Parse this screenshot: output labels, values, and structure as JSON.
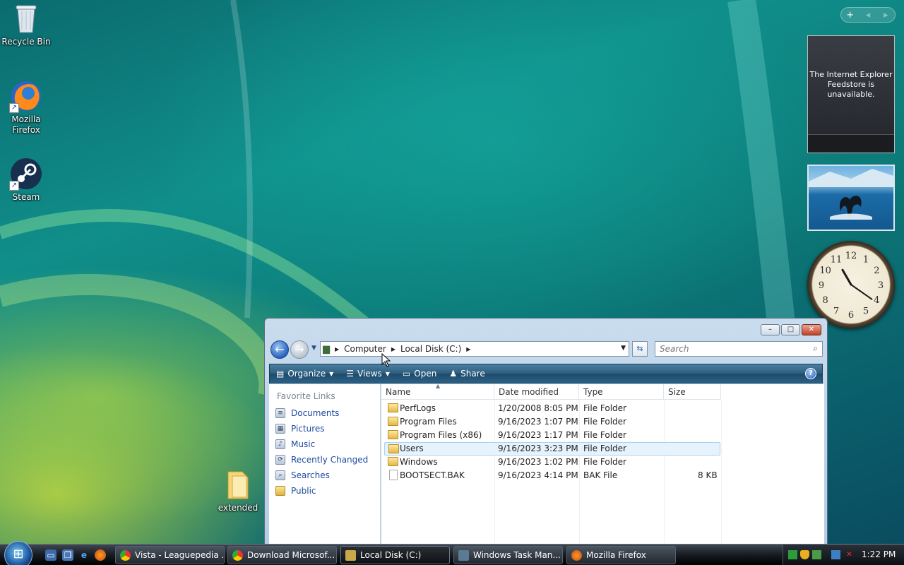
{
  "desktop": {
    "icons": [
      {
        "label": "Recycle Bin",
        "icon": "recycle-bin-icon"
      },
      {
        "label": "Mozilla\nFirefox",
        "line1": "Mozilla",
        "line2": "Firefox",
        "icon": "firefox-icon"
      },
      {
        "label": "Steam",
        "icon": "steam-icon"
      },
      {
        "label": "extended",
        "icon": "folder-icon"
      }
    ]
  },
  "sidebar": {
    "controls": {
      "add": "+",
      "prev": "◂",
      "next": "▸"
    },
    "feed_message_1": "The Internet Explorer",
    "feed_message_2": "Feedstore is",
    "feed_message_3": "unavailable.",
    "clock_numbers": [
      "12",
      "1",
      "2",
      "3",
      "4",
      "5",
      "6",
      "7",
      "8",
      "9",
      "10",
      "11"
    ]
  },
  "explorer": {
    "address": {
      "seg1": "Computer",
      "seg2": "Local Disk (C:)"
    },
    "search_placeholder": "Search",
    "toolbar": {
      "organize": "Organize",
      "views": "Views",
      "open": "Open",
      "share": "Share"
    },
    "favorites_title": "Favorite Links",
    "favorites": [
      "Documents",
      "Pictures",
      "Music",
      "Recently Changed",
      "Searches",
      "Public"
    ],
    "columns": {
      "name": "Name",
      "date": "Date modified",
      "type": "Type",
      "size": "Size"
    },
    "rows": [
      {
        "name": "PerfLogs",
        "date": "1/20/2008 8:05 PM",
        "type": "File Folder",
        "size": "",
        "kind": "folder"
      },
      {
        "name": "Program Files",
        "date": "9/16/2023 1:07 PM",
        "type": "File Folder",
        "size": "",
        "kind": "folder"
      },
      {
        "name": "Program Files (x86)",
        "date": "9/16/2023 1:17 PM",
        "type": "File Folder",
        "size": "",
        "kind": "folder"
      },
      {
        "name": "Users",
        "date": "9/16/2023 3:23 PM",
        "type": "File Folder",
        "size": "",
        "kind": "folder",
        "selected": true
      },
      {
        "name": "Windows",
        "date": "9/16/2023 1:02 PM",
        "type": "File Folder",
        "size": "",
        "kind": "folder"
      },
      {
        "name": "BOOTSECT.BAK",
        "date": "9/16/2023 4:14 PM",
        "type": "BAK File",
        "size": "8 KB",
        "kind": "file"
      }
    ]
  },
  "taskbar": {
    "tasks": [
      {
        "label": "Vista - Leaguepedia ...",
        "icon": "chrome-icon"
      },
      {
        "label": "Download Microsof...",
        "icon": "chrome-icon"
      },
      {
        "label": "Local Disk (C:)",
        "icon": "explorer-icon",
        "active": true
      },
      {
        "label": "Windows Task Man...",
        "icon": "task-manager-icon"
      },
      {
        "label": "Mozilla Firefox",
        "icon": "firefox-icon"
      }
    ],
    "time": "1:22 PM"
  },
  "colors": {
    "toolbar": "#2d5d7f",
    "link": "#1e4aa0",
    "selected_row": "#e6f2fc"
  }
}
